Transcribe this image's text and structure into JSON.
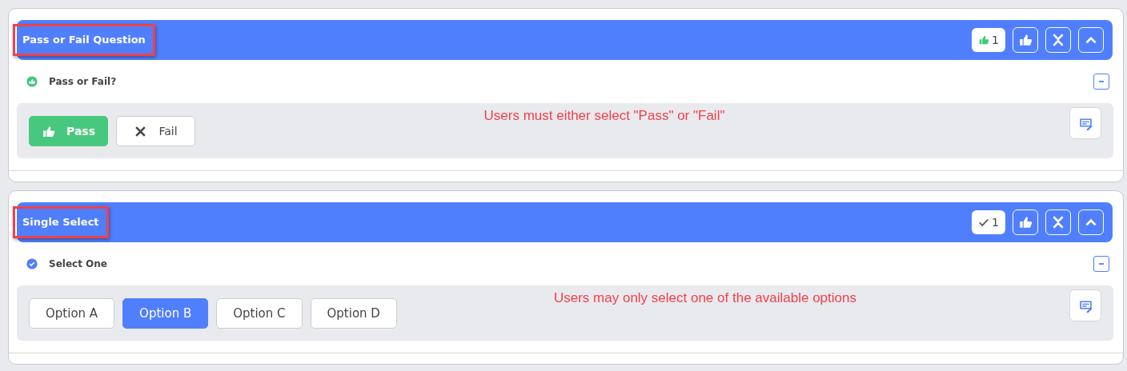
{
  "sections": [
    {
      "kind": "pass_fail",
      "title": "Pass or Fail Question",
      "badge": {
        "kind": "thumb",
        "count": "1"
      },
      "question": "Pass or Fail?",
      "note": "Users must either select \"Pass\" or \"Fail\"",
      "choices": [
        {
          "kind": "pass",
          "label": "Pass",
          "selected": true
        },
        {
          "kind": "fail",
          "label": "Fail",
          "selected": false
        }
      ]
    },
    {
      "kind": "single_select",
      "title": "Single Select",
      "badge": {
        "kind": "check",
        "count": "1"
      },
      "question": "Select One",
      "note": "Users may only select one of the available options",
      "choices": [
        {
          "kind": "option",
          "label": "Option A",
          "selected": false
        },
        {
          "kind": "option",
          "label": "Option B",
          "selected": true
        },
        {
          "kind": "option",
          "label": "Option C",
          "selected": false
        },
        {
          "kind": "option",
          "label": "Option D",
          "selected": false
        }
      ]
    }
  ]
}
